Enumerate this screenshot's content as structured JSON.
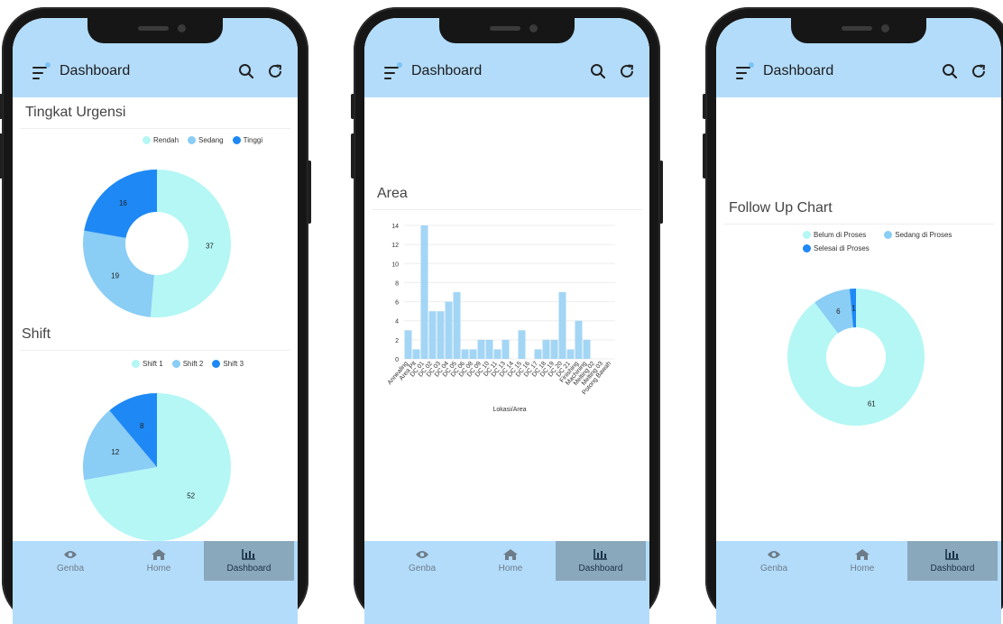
{
  "app": {
    "title": "Dashboard",
    "nav": [
      {
        "label": "Genba",
        "icon": "eye-icon"
      },
      {
        "label": "Home",
        "icon": "home-icon"
      },
      {
        "label": "Dashboard",
        "icon": "bar-chart-icon",
        "active": true
      }
    ]
  },
  "colors": {
    "appbar": "#b3dcfb",
    "light": "#b4f7f5",
    "mid": "#8acdf5",
    "dark": "#1e88f5",
    "bar": "#a3d5f5",
    "nav_active": "#8aa8bc"
  },
  "phone1": {
    "urgency_title": "Tingkat Urgensi",
    "shift_title": "Shift"
  },
  "phone2": {
    "area_title": "Area"
  },
  "phone3": {
    "followup_title": "Follow Up Chart"
  },
  "chart_data": [
    {
      "type": "pie",
      "title": "Tingkat Urgensi",
      "donut": true,
      "labels": [
        "Rendah",
        "Sedang",
        "Tinggi"
      ],
      "values": [
        37,
        19,
        16
      ],
      "colors": [
        "#b4f7f5",
        "#8acdf5",
        "#1e88f5"
      ],
      "legend": "top-right"
    },
    {
      "type": "pie",
      "title": "Shift",
      "donut": false,
      "labels": [
        "Shift 1",
        "Shift 2",
        "Shift 3"
      ],
      "values": [
        52,
        12,
        8
      ],
      "colors": [
        "#b4f7f5",
        "#8acdf5",
        "#1e88f5"
      ],
      "legend": "top-right"
    },
    {
      "type": "bar",
      "title": "Area",
      "xlabel": "Lokasi/Area",
      "ylabel": "",
      "ylim": [
        0,
        14
      ],
      "yticks": [
        0,
        2,
        4,
        6,
        8,
        10,
        12,
        14
      ],
      "grid": true,
      "categories": [
        "Annealing",
        "Area Pit",
        "DC 01",
        "DC 02",
        "DC 03",
        "DC 04",
        "DC 05",
        "DC 06",
        "DC 08",
        "DC 09",
        "DC 10",
        "DC 11",
        "DC 13",
        "DC 14",
        "DC 15",
        "DC 16",
        "DC 17",
        "DC 18",
        "DC 19",
        "DC 20",
        "DC 21",
        "Finishing",
        "Machining",
        "Melting 02",
        "Melting 03",
        "Potong Bawah"
      ],
      "values": [
        3,
        1,
        14,
        5,
        5,
        6,
        7,
        1,
        1,
        2,
        2,
        1,
        2,
        0,
        3,
        0,
        1,
        2,
        2,
        7,
        1,
        4,
        2,
        0,
        0,
        0
      ],
      "color": "#a3d5f5"
    },
    {
      "type": "pie",
      "title": "Follow Up Chart",
      "donut": true,
      "labels": [
        "Belum di Proses",
        "Sedang di Proses",
        "Selesai di Proses"
      ],
      "values": [
        61,
        6,
        1
      ],
      "colors": [
        "#b4f7f5",
        "#8acdf5",
        "#1e88f5"
      ],
      "legend": "top"
    }
  ]
}
